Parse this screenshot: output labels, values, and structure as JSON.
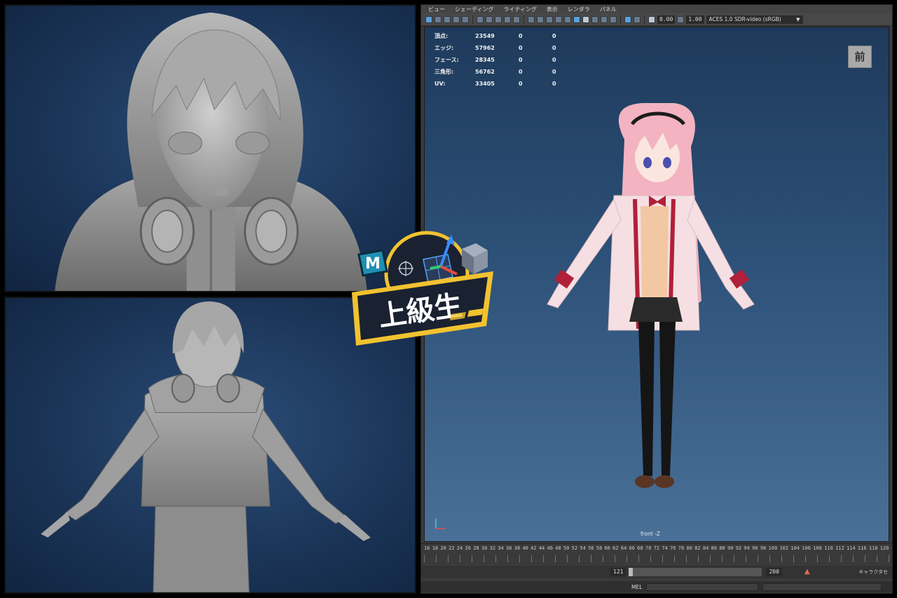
{
  "maya": {
    "menu": [
      {
        "label": "ビュー",
        "dim": false
      },
      {
        "label": "シェーディング",
        "dim": false
      },
      {
        "label": "ライティング",
        "dim": false
      },
      {
        "label": "表示",
        "dim": false
      },
      {
        "label": "レンダラ",
        "dim": false
      },
      {
        "label": "パネル",
        "dim": false
      }
    ],
    "toolbar": {
      "value_a": "0.00",
      "value_b": "1.00",
      "color_space": "ACES 1.0 SDR-video (sRGB)"
    },
    "hud": [
      {
        "label": "頂点:",
        "value": "23549",
        "a": "0",
        "b": "0"
      },
      {
        "label": "エッジ:",
        "value": "57962",
        "a": "0",
        "b": "0"
      },
      {
        "label": "フェース:",
        "value": "28345",
        "a": "0",
        "b": "0"
      },
      {
        "label": "三角形:",
        "value": "56762",
        "a": "0",
        "b": "0"
      },
      {
        "label": "UV:",
        "value": "33405",
        "a": "0",
        "b": "0"
      }
    ],
    "view_button": "前",
    "camera_label": "front -Z",
    "timeline_ticks": [
      "16",
      "18",
      "20",
      "22",
      "24",
      "26",
      "28",
      "30",
      "32",
      "34",
      "36",
      "38",
      "40",
      "42",
      "44",
      "46",
      "48",
      "50",
      "52",
      "54",
      "56",
      "58",
      "60",
      "62",
      "64",
      "66",
      "68",
      "70",
      "72",
      "74",
      "76",
      "78",
      "80",
      "82",
      "84",
      "86",
      "88",
      "90",
      "92",
      "94",
      "96",
      "98",
      "100",
      "102",
      "104",
      "106",
      "108",
      "110",
      "112",
      "114",
      "116",
      "118",
      "120"
    ],
    "range": {
      "current": "121",
      "end": "200"
    },
    "char_set_label": "キャラクタセ",
    "cmd_label": "MEL"
  },
  "badge": {
    "title": "上級生",
    "app_letter": "M"
  },
  "colors": {
    "viewport_top": "#1e3a5b",
    "viewport_bottom": "#4a7098",
    "badge_gold": "#f2c230",
    "badge_dark": "#1a2231",
    "hair_pink": "#f3b3c1",
    "ribbon_red": "#b0203a"
  }
}
